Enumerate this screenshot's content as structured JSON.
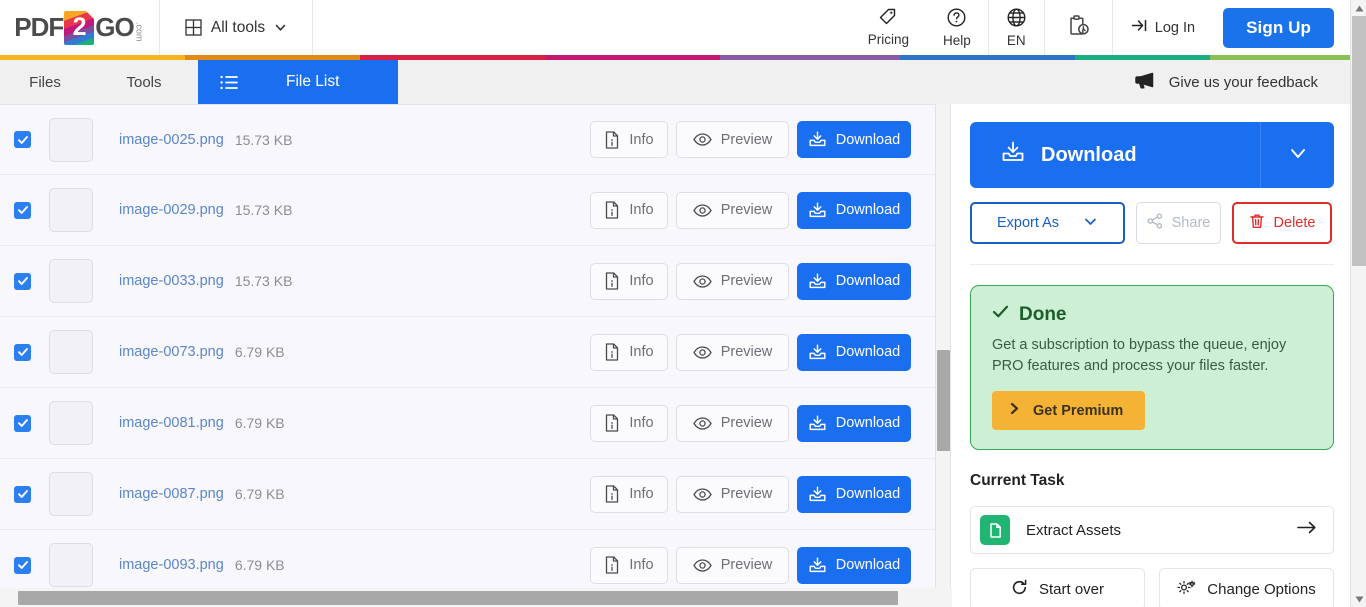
{
  "header": {
    "logo": {
      "pdf": "PDF",
      "two": "2",
      "go": "GO",
      "dotcom": ".com"
    },
    "all_tools": "All tools",
    "pricing": "Pricing",
    "help": "Help",
    "language": "EN",
    "login": "Log In",
    "signup": "Sign Up"
  },
  "rainbow": [
    "#f4b61a",
    "#e08a14",
    "#d81f46",
    "#c2186e",
    "#8a5aa8",
    "#2f73c4",
    "#19ad80",
    "#8cbf55"
  ],
  "tabs": {
    "files": "Files",
    "tools": "Tools",
    "file_list": "File List",
    "feedback": "Give us your feedback"
  },
  "file_list": {
    "buttons": {
      "info": "Info",
      "preview": "Preview",
      "download": "Download"
    },
    "rows": [
      {
        "name": "image-0025.png",
        "size": "15.73 KB",
        "checked": true
      },
      {
        "name": "image-0029.png",
        "size": "15.73 KB",
        "checked": true
      },
      {
        "name": "image-0033.png",
        "size": "15.73 KB",
        "checked": true
      },
      {
        "name": "image-0073.png",
        "size": "6.79 KB",
        "checked": true
      },
      {
        "name": "image-0081.png",
        "size": "6.79 KB",
        "checked": true
      },
      {
        "name": "image-0087.png",
        "size": "6.79 KB",
        "checked": true
      },
      {
        "name": "image-0093.png",
        "size": "6.79 KB",
        "checked": true
      }
    ]
  },
  "sidebar": {
    "download": "Download",
    "export_as": "Export As",
    "share": "Share",
    "delete": "Delete",
    "done": {
      "title": "Done",
      "text": "Get a subscription to bypass the queue, enjoy PRO features and process your files faster.",
      "button": "Get Premium"
    },
    "current_task_title": "Current Task",
    "task_name": "Extract Assets",
    "start_over": "Start over",
    "change_options": "Change Options"
  },
  "colors": {
    "primary_blue": "#1a6ef0",
    "signup_blue": "#1a73ea",
    "checkbox_blue": "#2b7ff0",
    "done_bg": "#cdf0d4",
    "done_border": "#3aa655",
    "premium_orange": "#f5b335",
    "delete_red": "#e02b2b",
    "task_green": "#20b573",
    "row_bg": "#f7f7fc",
    "filename_blue": "#5b86c9"
  }
}
